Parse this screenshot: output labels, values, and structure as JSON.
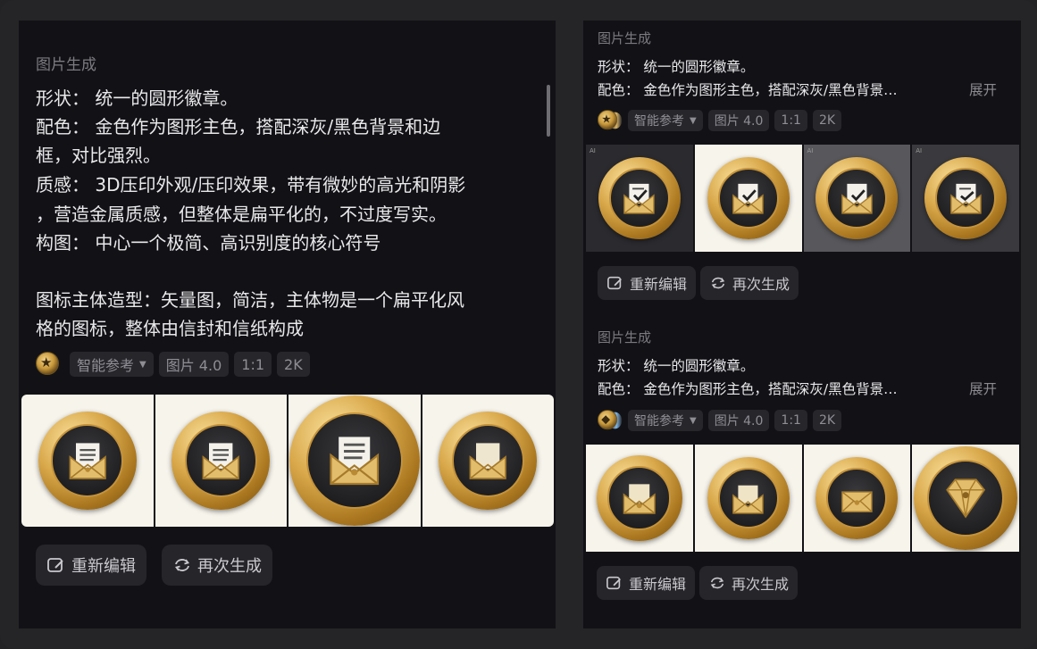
{
  "left": {
    "type_label": "图片生成",
    "prompt_lines": [
      "形状：  统一的圆形徽章。",
      "配色：  金色作为图形主色，搭配深灰/黑色背景和边",
      "框，对比强烈。",
      "质感：   3D压印外观/压印效果，带有微妙的高光和阴影",
      "，营造金属质感，但整体是扁平化的，不过度写实。",
      "构图：  中心一个极简、高识别度的核心符号",
      "",
      "图标主体造型：矢量图，简洁，主体物是一个扁平化风",
      "格的图标，整体由信封和信纸构成"
    ],
    "chips": {
      "reference": "智能参考",
      "model": "图片 4.0",
      "ratio": "1:1",
      "resolution": "2K"
    },
    "images": [
      {
        "icon": "envelope-letter-icon",
        "bg": "cream"
      },
      {
        "icon": "envelope-letter-icon",
        "bg": "cream"
      },
      {
        "icon": "envelope-letter-icon",
        "bg": "cream"
      },
      {
        "icon": "envelope-letter-icon",
        "bg": "cream"
      }
    ],
    "buttons": {
      "edit": "重新编辑",
      "regenerate": "再次生成"
    }
  },
  "right_top": {
    "type_label": "图片生成",
    "prompt_lines": [
      "形状：  统一的圆形徽章。",
      "配色：  金色作为图形主色，搭配深灰/黑色背景…"
    ],
    "expand": "展开",
    "chips": {
      "reference": "智能参考",
      "model": "图片 4.0",
      "ratio": "1:1",
      "resolution": "2K"
    },
    "images": [
      {
        "icon": "envelope-check-icon",
        "bg": "dark"
      },
      {
        "icon": "envelope-check-icon",
        "bg": "cream"
      },
      {
        "icon": "envelope-check-icon",
        "bg": "gray"
      },
      {
        "icon": "envelope-check-icon",
        "bg": "mid"
      }
    ],
    "buttons": {
      "edit": "重新编辑",
      "regenerate": "再次生成"
    }
  },
  "right_bottom": {
    "type_label": "图片生成",
    "prompt_lines": [
      "形状：  统一的圆形徽章。",
      "配色：  金色作为图形主色，搭配深灰/黑色背景…"
    ],
    "expand": "展开",
    "chips": {
      "reference": "智能参考",
      "model": "图片 4.0",
      "ratio": "1:1",
      "resolution": "2K"
    },
    "images": [
      {
        "icon": "envelope-icon",
        "bg": "cream"
      },
      {
        "icon": "envelope-icon",
        "bg": "cream"
      },
      {
        "icon": "envelope-icon",
        "bg": "cream"
      },
      {
        "icon": "diamond-icon",
        "bg": "cream"
      }
    ],
    "buttons": {
      "edit": "重新编辑",
      "regenerate": "再次生成"
    }
  },
  "colors": {
    "gold": "#d9a84a",
    "panel_bg": "#121216",
    "chip_bg": "#26262b"
  }
}
